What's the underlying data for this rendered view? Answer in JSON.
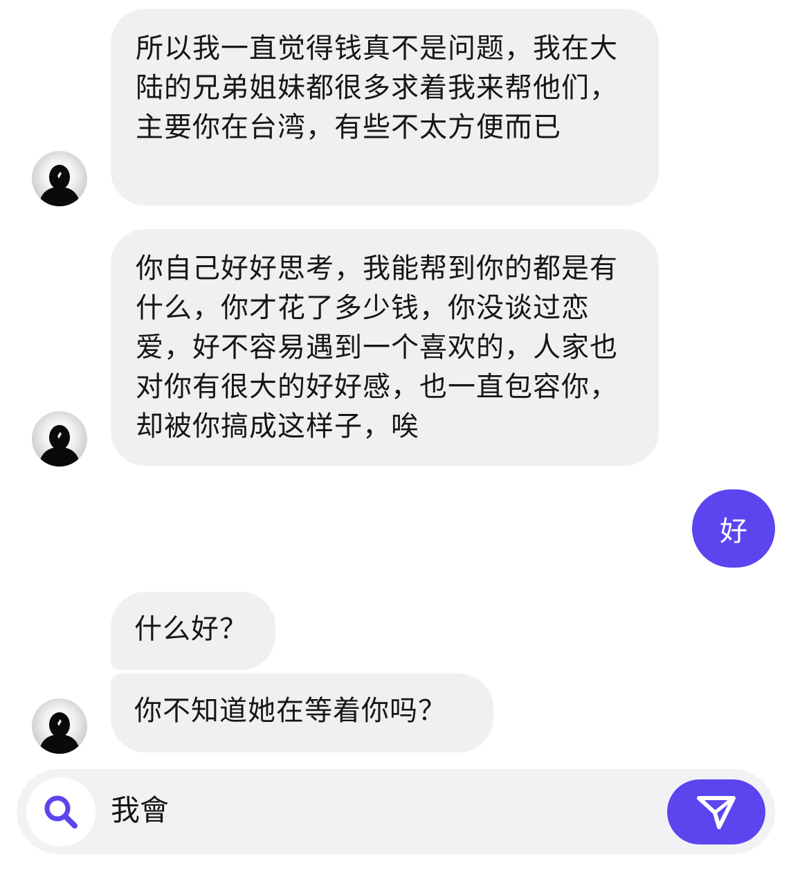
{
  "conversation": {
    "messages": [
      {
        "side": "received",
        "text": "所以我一直觉得钱真不是问题，我在大陆的兄弟姐妹都很多求着我来帮他们，主要你在台湾，有些不太方便而已"
      },
      {
        "side": "received",
        "text": "你自己好好思考，我能帮到你的都是有什么，你才花了多少钱，你没谈过恋爱，好不容易遇到一个喜欢的，人家也对你有很大的好好感，也一直包容你，却被你搞成这样子，唉"
      },
      {
        "side": "sent",
        "text": "好"
      },
      {
        "side": "received",
        "text": "什么好？"
      },
      {
        "side": "received",
        "text": "你不知道她在等着你吗？"
      }
    ]
  },
  "composer": {
    "value": "我會",
    "search_icon": "search-icon",
    "send_icon": "paper-plane-icon"
  },
  "colors": {
    "accent": "#5b45ee",
    "received_bubble": "#f0f0f3",
    "composer_bg": "#f2f2f5"
  }
}
